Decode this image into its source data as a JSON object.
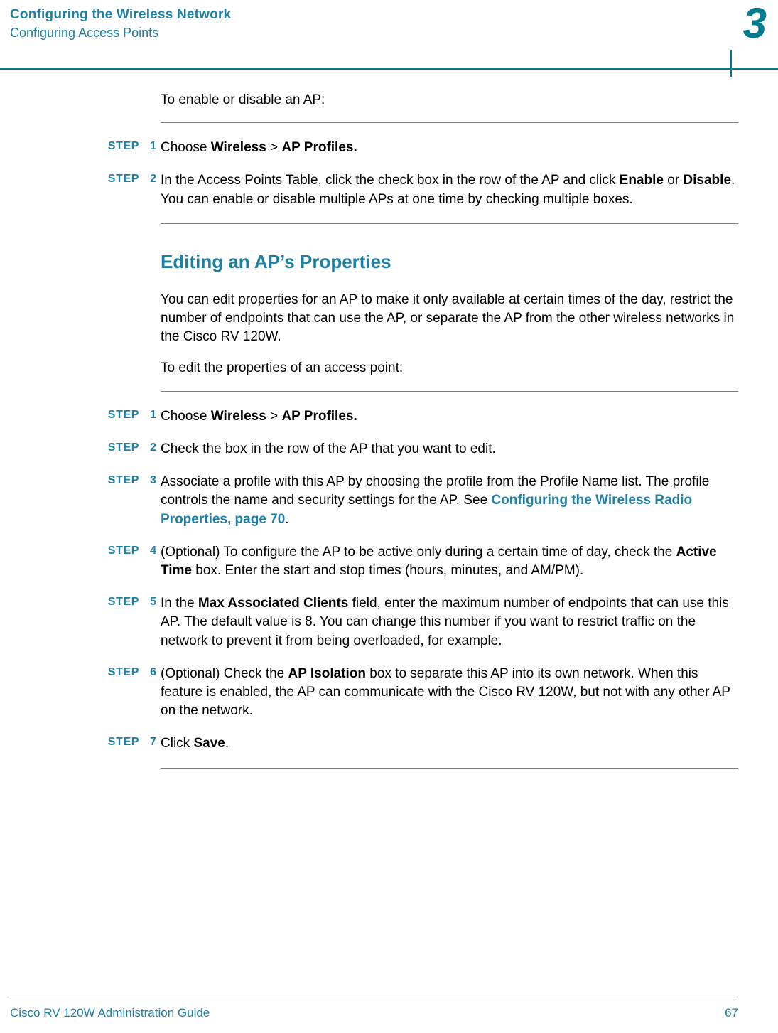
{
  "header": {
    "chapter_title": "Configuring the Wireless Network",
    "chapter_sub": "Configuring Access Points",
    "chapter_number": "3"
  },
  "section1": {
    "intro": "To enable or disable an AP:",
    "steps": [
      {
        "label": "STEP",
        "num": "1",
        "parts": [
          {
            "t": "Choose "
          },
          {
            "t": "Wireless",
            "b": true
          },
          {
            "t": " > "
          },
          {
            "t": "AP Profiles.",
            "b": true
          }
        ]
      },
      {
        "label": "STEP",
        "num": "2",
        "parts": [
          {
            "t": "In the Access Points Table, click the check box in the row of the AP and click "
          },
          {
            "t": "Enable",
            "b": true
          },
          {
            "t": " or "
          },
          {
            "t": "Disable",
            "b": true
          },
          {
            "t": ". You can enable or disable multiple APs at one time by checking multiple boxes."
          }
        ]
      }
    ]
  },
  "section2": {
    "heading": "Editing an AP’s Properties",
    "para1": "You can edit properties for an AP to make it only available at certain times of the day, restrict the number of endpoints that can use the AP, or separate the AP from the other wireless networks in the Cisco RV 120W.",
    "para2": "To edit the properties of an access point:",
    "steps": [
      {
        "label": "STEP",
        "num": "1",
        "parts": [
          {
            "t": "Choose "
          },
          {
            "t": "Wireless",
            "b": true
          },
          {
            "t": " > "
          },
          {
            "t": "AP Profiles.",
            "b": true
          }
        ]
      },
      {
        "label": "STEP",
        "num": "2",
        "parts": [
          {
            "t": "Check the box in the row of the AP that you want to edit."
          }
        ]
      },
      {
        "label": "STEP",
        "num": "3",
        "parts": [
          {
            "t": "Associate a profile with this AP by choosing the profile from the Profile Name list. The profile controls the name and security settings for the AP. See "
          },
          {
            "t": "Configuring the Wireless Radio Properties, page 70",
            "link": true
          },
          {
            "t": "."
          }
        ]
      },
      {
        "label": "STEP",
        "num": "4",
        "parts": [
          {
            "t": "(Optional) To configure the AP to be active only during a certain time of day, check the "
          },
          {
            "t": "Active Time",
            "b": true
          },
          {
            "t": " box. Enter the start and stop times (hours, minutes, and AM/PM)."
          }
        ]
      },
      {
        "label": "STEP",
        "num": "5",
        "parts": [
          {
            "t": "In the "
          },
          {
            "t": "Max Associated Clients",
            "b": true
          },
          {
            "t": " field, enter the maximum number of endpoints that can use this AP. The default value is 8. You can change this number if you want to restrict traffic on the network to prevent it from being overloaded, for example."
          }
        ]
      },
      {
        "label": "STEP",
        "num": "6",
        "parts": [
          {
            "t": "(Optional) Check the "
          },
          {
            "t": "AP Isolation",
            "b": true
          },
          {
            "t": " box to separate this AP into its own network. When this feature is enabled, the AP can communicate with the Cisco RV 120W, but not with any other AP on the network."
          }
        ]
      },
      {
        "label": "STEP",
        "num": "7",
        "parts": [
          {
            "t": "Click "
          },
          {
            "t": "Save",
            "b": true
          },
          {
            "t": "."
          }
        ]
      }
    ]
  },
  "footer": {
    "guide": "Cisco RV 120W Administration Guide",
    "page": "67"
  }
}
